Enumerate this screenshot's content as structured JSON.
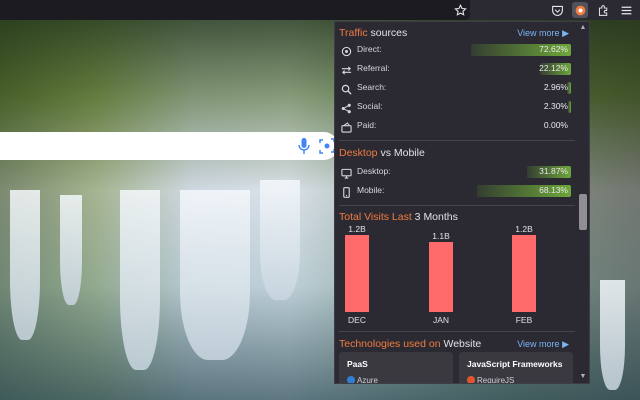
{
  "traffic": {
    "title_accent": "Traffic",
    "title_rest": " sources",
    "view_more": "View more",
    "rows": [
      {
        "label": "Direct:",
        "value": "72.62%",
        "fraction": 0.7262,
        "icon": "target-icon"
      },
      {
        "label": "Referral:",
        "value": "22.12%",
        "fraction": 0.2212,
        "icon": "swap-arrows-icon"
      },
      {
        "label": "Search:",
        "value": "2.96%",
        "fraction": 0.0296,
        "icon": "magnifier-icon"
      },
      {
        "label": "Social:",
        "value": "2.30%",
        "fraction": 0.023,
        "icon": "share-icon"
      },
      {
        "label": "Paid:",
        "value": "0.00%",
        "fraction": 0.0,
        "icon": "wallet-icon"
      }
    ]
  },
  "device": {
    "title_accent": "Desktop",
    "title_rest": " vs Mobile",
    "rows": [
      {
        "label": "Desktop:",
        "value": "31.87%",
        "fraction": 0.3187,
        "icon": "monitor-icon"
      },
      {
        "label": "Mobile:",
        "value": "68.13%",
        "fraction": 0.6813,
        "icon": "phone-icon"
      }
    ]
  },
  "visits": {
    "title_accent": "Total Visits Last",
    "title_rest": " 3 Months"
  },
  "chart_data": {
    "type": "bar",
    "title": "Total Visits Last 3 Months",
    "categories": [
      "DEC",
      "JAN",
      "FEB"
    ],
    "values": [
      1.2,
      1.1,
      1.2
    ],
    "data_labels": [
      "1.2B",
      "1.1B",
      "1.2B"
    ],
    "ylim": [
      0,
      1.25
    ],
    "grid": false,
    "color": "#ff6b6b"
  },
  "tech": {
    "title_accent": "Technologies used on",
    "title_rest": " Website",
    "view_more": "View more",
    "cards": [
      {
        "title": "PaaS",
        "item": "Azure",
        "dot_color": "#2f7fd6"
      },
      {
        "title": "JavaScript Frameworks",
        "item": "RequireJS",
        "dot_color": "#e0552f"
      }
    ]
  },
  "colors": {
    "accent": "#f07c3f",
    "link": "#7ab4f5",
    "bar_green": "#6da73a",
    "panel_bg": "#2b2a33"
  }
}
